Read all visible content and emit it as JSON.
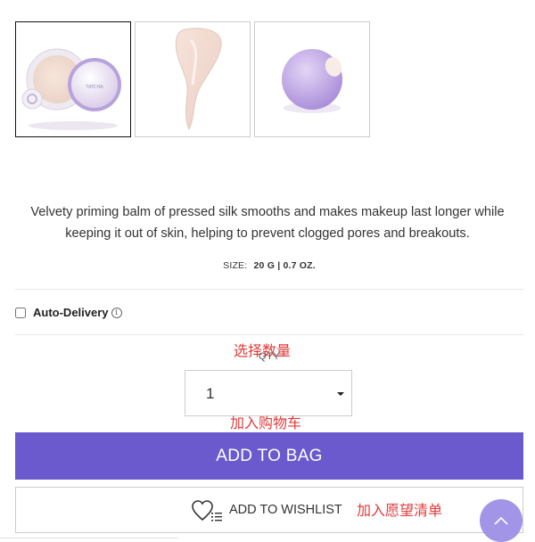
{
  "gallery": {
    "thumbnails": [
      {
        "alt": "product-compact-icon",
        "selected": true
      },
      {
        "alt": "product-swatch-icon",
        "selected": false
      },
      {
        "alt": "product-texture-icon",
        "selected": false
      }
    ]
  },
  "product": {
    "description": "Velvety priming balm of pressed silk smooths and makes makeup last longer while keeping it out of skin, helping to prevent clogged pores and breakouts.",
    "size_label": "SIZE:",
    "size_value": "20 G | 0.7 OZ."
  },
  "autodelivery": {
    "label": "Auto-Delivery",
    "checked": false,
    "info_icon": "i"
  },
  "annotations": {
    "select_qty": "选择数量",
    "add_to_cart": "加入购物车",
    "add_to_wishlist": "加入愿望清单"
  },
  "quantity": {
    "label": "QTY",
    "value": "1"
  },
  "actions": {
    "add_to_bag": "ADD TO BAG",
    "add_to_wishlist": "ADD TO WISHLIST"
  },
  "colors": {
    "accent": "#6a5acd",
    "scroll_button": "#a294e6",
    "annotation_red": "#e23a3a"
  }
}
